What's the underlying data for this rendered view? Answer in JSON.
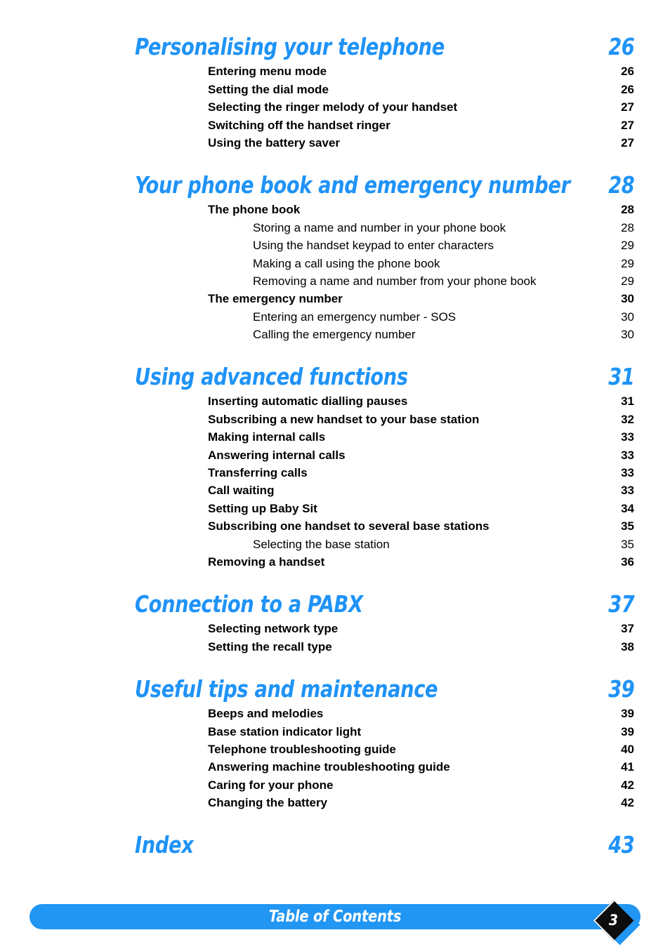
{
  "document": {
    "footer_title": "Table of Contents",
    "page_number": "3",
    "accent_color": "#2196f3",
    "text_color": "#000000"
  },
  "toc": {
    "sections": [
      {
        "title": "Personalising your telephone",
        "page": "26",
        "entries": [
          {
            "level": 2,
            "title": "Entering menu mode",
            "page": "26"
          },
          {
            "level": 2,
            "title": "Setting the dial mode",
            "page": "26"
          },
          {
            "level": 2,
            "title": "Selecting the ringer melody of your handset",
            "page": "27"
          },
          {
            "level": 2,
            "title": "Switching off the handset ringer",
            "page": "27"
          },
          {
            "level": 2,
            "title": "Using the battery saver",
            "page": "27"
          }
        ]
      },
      {
        "title": "Your phone book and emergency number",
        "page": "28",
        "entries": [
          {
            "level": 2,
            "title": "The phone book",
            "page": "28"
          },
          {
            "level": 3,
            "title": "Storing a name and number in your phone book",
            "page": "28"
          },
          {
            "level": 3,
            "title": "Using the handset keypad to enter characters",
            "page": "29"
          },
          {
            "level": 3,
            "title": "Making a call using the phone book",
            "page": "29"
          },
          {
            "level": 3,
            "title": "Removing a name and number from your phone book",
            "page": "29"
          },
          {
            "level": 2,
            "title": "The emergency number",
            "page": "30"
          },
          {
            "level": 3,
            "title": "Entering an emergency number - SOS",
            "page": "30"
          },
          {
            "level": 3,
            "title": "Calling the emergency number",
            "page": "30"
          }
        ]
      },
      {
        "title": "Using advanced functions",
        "page": "31",
        "entries": [
          {
            "level": 2,
            "title": "Inserting automatic dialling pauses",
            "page": "31"
          },
          {
            "level": 2,
            "title": "Subscribing a new handset to your base station",
            "page": "32"
          },
          {
            "level": 2,
            "title": "Making internal calls",
            "page": "33"
          },
          {
            "level": 2,
            "title": "Answering internal calls",
            "page": "33"
          },
          {
            "level": 2,
            "title": "Transferring calls",
            "page": "33"
          },
          {
            "level": 2,
            "title": "Call waiting",
            "page": "33"
          },
          {
            "level": 2,
            "title": "Setting up Baby Sit",
            "page": "34"
          },
          {
            "level": 2,
            "title": "Subscribing one handset to several base stations",
            "page": "35"
          },
          {
            "level": 3,
            "title": "Selecting the base station",
            "page": "35"
          },
          {
            "level": 2,
            "title": "Removing a handset",
            "page": "36"
          }
        ]
      },
      {
        "title": "Connection to a PABX",
        "page": "37",
        "entries": [
          {
            "level": 2,
            "title": "Selecting network type",
            "page": "37"
          },
          {
            "level": 2,
            "title": "Setting the recall type",
            "page": "38"
          }
        ]
      },
      {
        "title": "Useful tips and maintenance",
        "page": "39",
        "entries": [
          {
            "level": 2,
            "title": "Beeps and melodies",
            "page": "39"
          },
          {
            "level": 2,
            "title": "Base station indicator light",
            "page": "39"
          },
          {
            "level": 2,
            "title": "Telephone troubleshooting guide",
            "page": "40"
          },
          {
            "level": 2,
            "title": "Answering machine troubleshooting guide",
            "page": "41"
          },
          {
            "level": 2,
            "title": "Caring for your phone",
            "page": "42"
          },
          {
            "level": 2,
            "title": "Changing the battery",
            "page": "42"
          }
        ]
      },
      {
        "title": "Index",
        "page": "43",
        "entries": []
      }
    ]
  }
}
